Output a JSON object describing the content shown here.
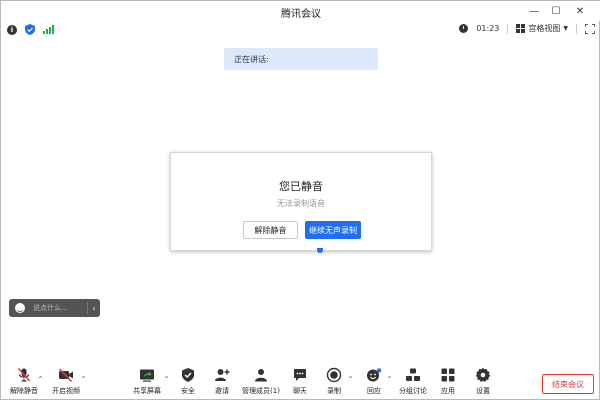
{
  "window": {
    "title": "腾讯会议",
    "minimize_glyph": "—",
    "maximize_glyph": "☐",
    "close_glyph": "✕"
  },
  "infobar": {
    "info_glyph": "i",
    "timer": "01:23",
    "view_label": "宫格视图",
    "view_caret": "▼"
  },
  "speaking": {
    "label": "正在讲话:"
  },
  "modal": {
    "title": "您已静音",
    "subtitle": "无法录制语音",
    "unmute_button": "解除静音",
    "continue_button": "继续无声录制"
  },
  "chat": {
    "placeholder": "说点什么...",
    "collapse_glyph": "‹"
  },
  "toolbar": {
    "caret_glyph": "^",
    "unmute": "解除静音",
    "start_video": "开启视频",
    "share_screen": "共享屏幕",
    "security": "安全",
    "invite": "邀请",
    "manage_members": "管理成员(1)",
    "chat": "聊天",
    "record": "录制",
    "reactions": "回应",
    "breakout": "分组讨论",
    "apps": "应用",
    "settings": "设置",
    "end_meeting": "结束会议"
  },
  "colors": {
    "accent": "#1f6ff2",
    "danger": "#e23a3a",
    "signal": "#19b34a",
    "banner": "#dbe9fb"
  }
}
